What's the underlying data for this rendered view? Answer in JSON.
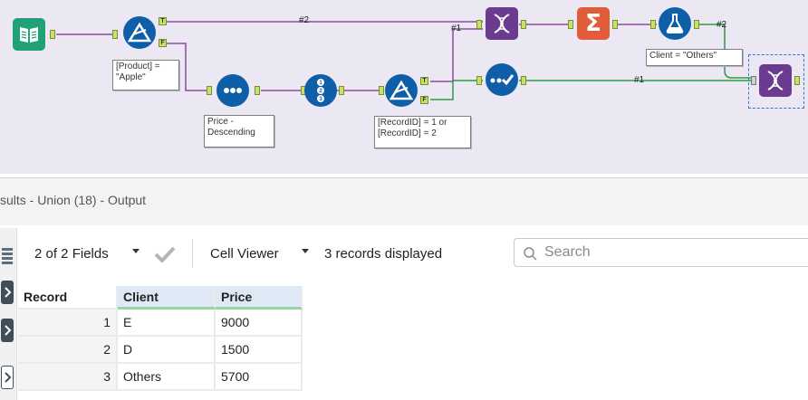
{
  "workflow": {
    "connection_labels": [
      "#2",
      "#1",
      "#2",
      "#1"
    ],
    "filter_product": {
      "text": "[Product] = \"Apple\"",
      "t_label": "T",
      "f_label": "F"
    },
    "sort_note": {
      "text": "Price - Descending"
    },
    "filter_record": {
      "text": "[RecordID] = 1 or [RecordID] = 2",
      "t_label": "T",
      "f_label": "F"
    },
    "formula_note": {
      "text": "Client = \"Others\""
    },
    "colors": {
      "canvas": "#ebe8f3",
      "input_tool": "#20a276",
      "prep_tool": "#0e5fa8",
      "join_tool": "#6b3b8f",
      "transform_tool": "#e15d3a",
      "wire_purple": "#8b4a9c",
      "wire_green": "#2e9a42",
      "selection": "#2a79d8"
    }
  },
  "results": {
    "title": "sults - Union (18) - Output"
  },
  "toolbar": {
    "fields_label": "2 of 2 Fields",
    "viewer_label": "Cell Viewer",
    "records_label": "3 records displayed",
    "search_placeholder": "Search"
  },
  "grid": {
    "headers": {
      "record": "Record",
      "client": "Client",
      "price": "Price"
    },
    "rows": [
      {
        "record": "1",
        "client": "E",
        "price": "9000"
      },
      {
        "record": "2",
        "client": "D",
        "price": "1500"
      },
      {
        "record": "3",
        "client": "Others",
        "price": "5700"
      }
    ]
  },
  "icons": [
    "book-icon",
    "filter-icon",
    "sort-icon",
    "record-id-icon",
    "dna-icon",
    "summarize-icon",
    "formula-icon",
    "check-icon",
    "checkmark-icon",
    "search-icon",
    "chevron-right-icon"
  ]
}
